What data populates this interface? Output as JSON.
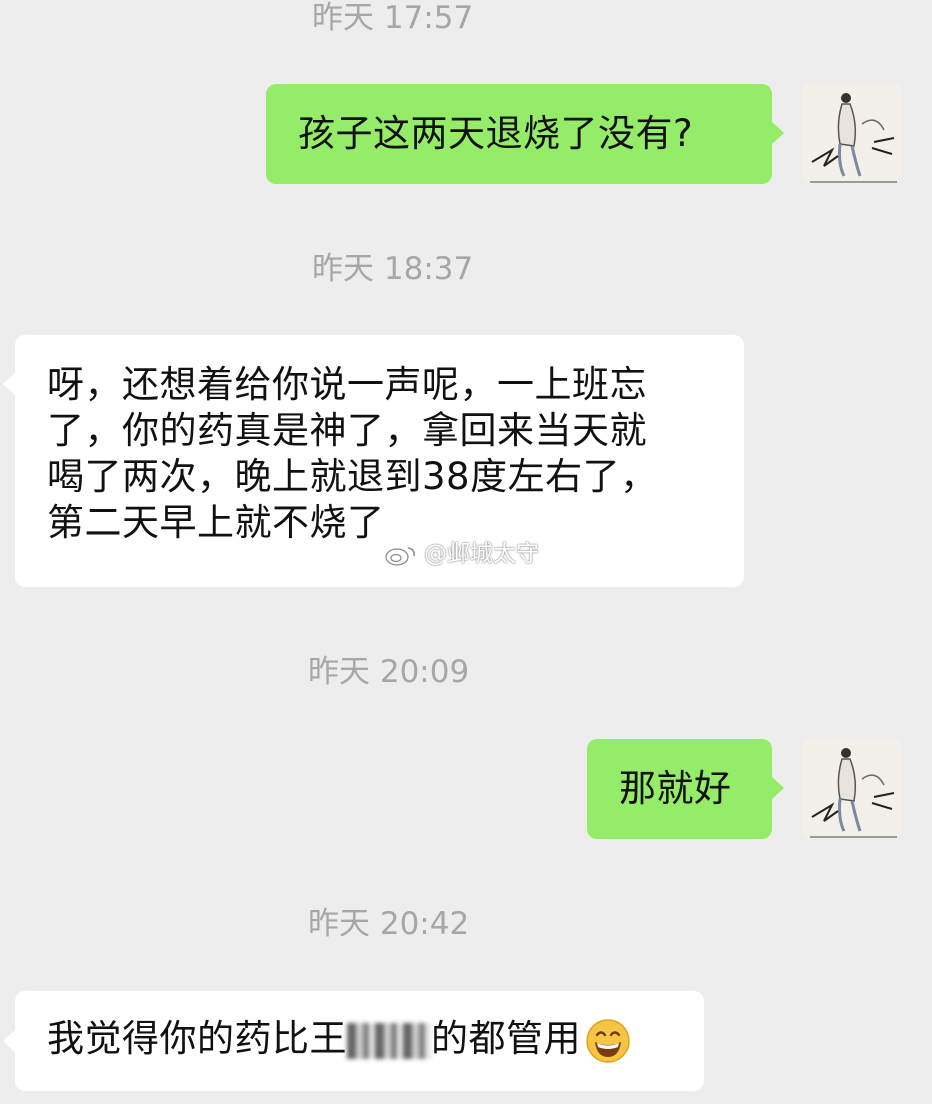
{
  "chat": {
    "messages": [
      {
        "timestamp": "昨天 17:57"
      },
      {
        "text": "孩子这两天退烧了没有?",
        "side": "me"
      },
      {
        "timestamp": "昨天 18:37"
      },
      {
        "lines": [
          "呀，还想着给你说一声呢，一上班忘",
          "了，你的药真是神了，拿回来当天就",
          "喝了两次，晚上就退到38度左右了，",
          "第二天早上就不烧了"
        ],
        "side": "other"
      },
      {
        "timestamp": "昨天 20:09"
      },
      {
        "text": "那就好",
        "side": "me"
      },
      {
        "timestamp": "昨天 20:42"
      },
      {
        "text_before": "我觉得你的药比王",
        "text_after": "的都管用",
        "emoji": "grinning-face-emoji",
        "side": "other"
      }
    ]
  },
  "watermark": {
    "text": "@邺城太守",
    "icon": "weibo-icon"
  },
  "colors": {
    "background": "#ededed",
    "my_bubble": "#95ec69",
    "other_bubble": "#ffffff",
    "timestamp": "#a7a7a7"
  }
}
